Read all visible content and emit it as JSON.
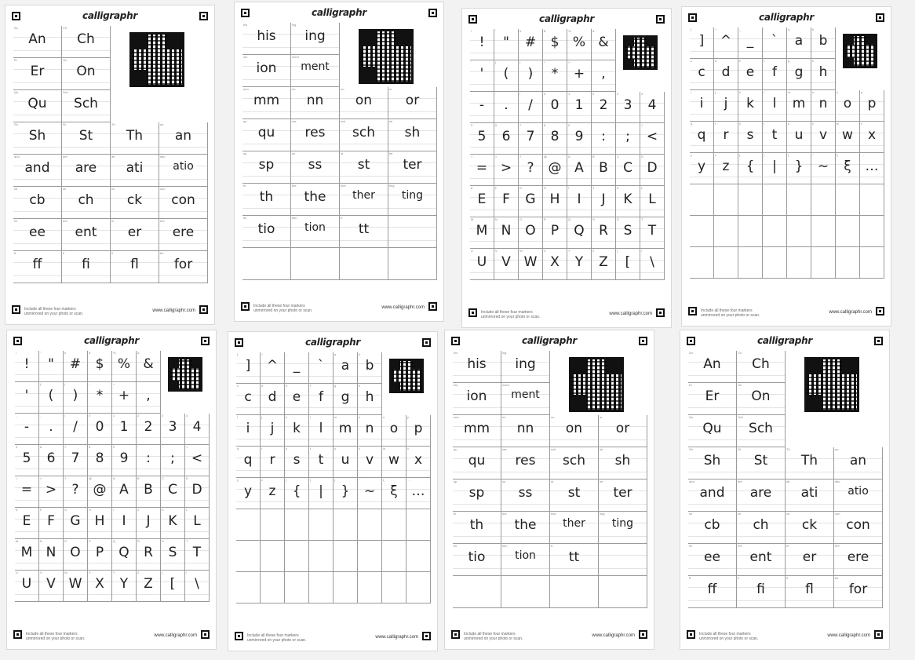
{
  "brand": "calligraphr",
  "footer": {
    "note_line1": "Include all these four markers",
    "note_line2": "unmirrored on your photo or scan.",
    "website": "www.calligraphr.com"
  },
  "sheets": [
    {
      "id": "ligatures-1",
      "qr": true,
      "top_rows": [
        [
          "An",
          "Ch"
        ],
        [
          "Er",
          "On"
        ],
        [
          "Qu",
          "Sch"
        ]
      ],
      "rows": [
        [
          "Sh",
          "St",
          "Th",
          "an"
        ],
        [
          "and",
          "are",
          "ati",
          "atio"
        ],
        [
          "cb",
          "ch",
          "ck",
          "con"
        ],
        [
          "ee",
          "ent",
          "er",
          "ere"
        ],
        [
          "ff",
          "fi",
          "fl",
          "for"
        ]
      ],
      "empty_rows": 0
    },
    {
      "id": "ligatures-2",
      "qr": true,
      "top_rows": [
        [
          "his",
          "ing"
        ],
        [
          "ion",
          "ment"
        ]
      ],
      "rows": [
        [
          "mm",
          "nn",
          "on",
          "or"
        ],
        [
          "qu",
          "res",
          "sch",
          "sh"
        ],
        [
          "sp",
          "ss",
          "st",
          "ter"
        ],
        [
          "th",
          "the",
          "ther",
          "ting"
        ],
        [
          "tio",
          "tion",
          "tt",
          ""
        ]
      ],
      "empty_rows": 1
    },
    {
      "id": "symbols-1",
      "qr": true,
      "top_rows": [
        [
          "!",
          "\"",
          "#",
          "$",
          "%",
          "&"
        ],
        [
          "'",
          "(",
          ")",
          "*",
          "+",
          ","
        ]
      ],
      "rows": [
        [
          "-",
          ".",
          "/",
          "0",
          "1",
          "2",
          "3",
          "4"
        ],
        [
          "5",
          "6",
          "7",
          "8",
          "9",
          ":",
          ";",
          "<"
        ],
        [
          "=",
          ">",
          "?",
          "@",
          "A",
          "B",
          "C",
          "D"
        ],
        [
          "E",
          "F",
          "G",
          "H",
          "I",
          "J",
          "K",
          "L"
        ],
        [
          "M",
          "N",
          "O",
          "P",
          "Q",
          "R",
          "S",
          "T"
        ],
        [
          "U",
          "V",
          "W",
          "X",
          "Y",
          "Z",
          "[",
          "\\"
        ]
      ],
      "empty_rows": 0
    },
    {
      "id": "symbols-2",
      "qr": true,
      "top_rows": [
        [
          "]",
          "^",
          "_",
          "`",
          "a",
          "b"
        ],
        [
          "c",
          "d",
          "e",
          "f",
          "g",
          "h"
        ]
      ],
      "rows": [
        [
          "i",
          "j",
          "k",
          "l",
          "m",
          "n",
          "o",
          "p"
        ],
        [
          "q",
          "r",
          "s",
          "t",
          "u",
          "v",
          "w",
          "x"
        ],
        [
          "y",
          "z",
          "{",
          "|",
          "}",
          "~",
          "ξ",
          "…"
        ]
      ],
      "empty_rows": 3
    },
    {
      "id": "symbols-1b",
      "qr": true,
      "top_rows": [
        [
          "!",
          "\"",
          "#",
          "$",
          "%",
          "&"
        ],
        [
          "'",
          "(",
          ")",
          "*",
          "+",
          ","
        ]
      ],
      "rows": [
        [
          "-",
          ".",
          "/",
          "0",
          "1",
          "2",
          "3",
          "4"
        ],
        [
          "5",
          "6",
          "7",
          "8",
          "9",
          ":",
          ";",
          "<"
        ],
        [
          "=",
          ">",
          "?",
          "@",
          "A",
          "B",
          "C",
          "D"
        ],
        [
          "E",
          "F",
          "G",
          "H",
          "I",
          "J",
          "K",
          "L"
        ],
        [
          "M",
          "N",
          "O",
          "P",
          "Q",
          "R",
          "S",
          "T"
        ],
        [
          "U",
          "V",
          "W",
          "X",
          "Y",
          "Z",
          "[",
          "\\"
        ]
      ],
      "empty_rows": 0
    },
    {
      "id": "symbols-2b",
      "qr": true,
      "top_rows": [
        [
          "]",
          "^",
          "_",
          "`",
          "a",
          "b"
        ],
        [
          "c",
          "d",
          "e",
          "f",
          "g",
          "h"
        ]
      ],
      "rows": [
        [
          "i",
          "j",
          "k",
          "l",
          "m",
          "n",
          "o",
          "p"
        ],
        [
          "q",
          "r",
          "s",
          "t",
          "u",
          "v",
          "w",
          "x"
        ],
        [
          "y",
          "z",
          "{",
          "|",
          "}",
          "~",
          "ξ",
          "…"
        ]
      ],
      "empty_rows": 3
    },
    {
      "id": "ligatures-2b",
      "qr": true,
      "top_rows": [
        [
          "his",
          "ing"
        ],
        [
          "ion",
          "ment"
        ]
      ],
      "rows": [
        [
          "mm",
          "nn",
          "on",
          "or"
        ],
        [
          "qu",
          "res",
          "sch",
          "sh"
        ],
        [
          "sp",
          "ss",
          "st",
          "ter"
        ],
        [
          "th",
          "the",
          "ther",
          "ting"
        ],
        [
          "tio",
          "tion",
          "tt",
          ""
        ]
      ],
      "empty_rows": 1
    },
    {
      "id": "ligatures-1b",
      "qr": true,
      "top_rows": [
        [
          "An",
          "Ch"
        ],
        [
          "Er",
          "On"
        ],
        [
          "Qu",
          "Sch"
        ]
      ],
      "rows": [
        [
          "Sh",
          "St",
          "Th",
          "an"
        ],
        [
          "and",
          "are",
          "ati",
          "atio"
        ],
        [
          "cb",
          "ch",
          "ck",
          "con"
        ],
        [
          "ee",
          "ent",
          "er",
          "ere"
        ],
        [
          "ff",
          "fi",
          "fl",
          "for"
        ]
      ],
      "empty_rows": 0
    }
  ]
}
